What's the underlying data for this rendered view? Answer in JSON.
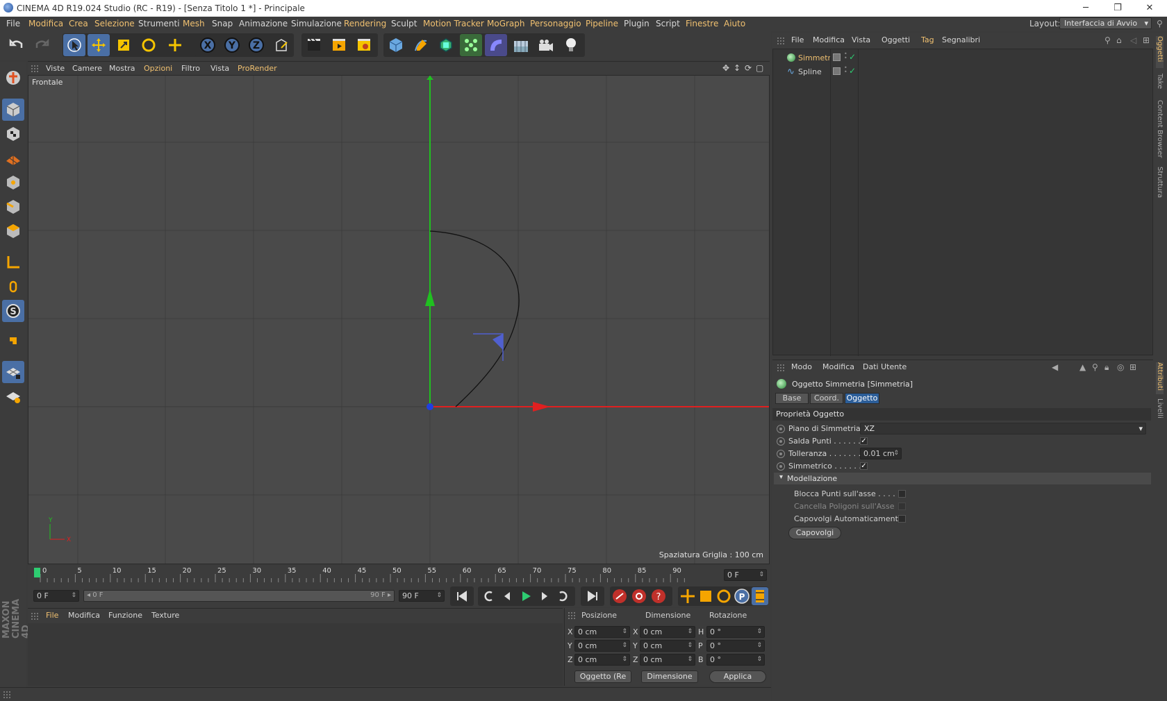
{
  "window": {
    "title": "CINEMA 4D R19.024 Studio (RC - R19) - [Senza Titolo 1 *] - Principale",
    "controls": [
      "─",
      "❐",
      "✕"
    ]
  },
  "menubar": {
    "items": [
      "File",
      "Modifica",
      "Crea",
      "Selezione",
      "Strumenti",
      "Mesh",
      "Snap",
      "Animazione",
      "Simulazione",
      "Rendering",
      "Sculpt",
      "Motion Tracker",
      "MoGraph",
      "Personaggio",
      "Pipeline",
      "Plugin",
      "Script",
      "Finestre",
      "Aiuto"
    ],
    "layout_label": "Layout:",
    "layout_value": "Interfaccia di Avvio"
  },
  "viewport": {
    "menu": [
      "Viste",
      "Camere",
      "Mostra",
      "Opzioni",
      "Filtro",
      "Vista",
      "ProRender"
    ],
    "view_name": "Frontale",
    "grid_info": "Spaziatura Griglia : 100 cm",
    "axis_y": "Y",
    "axis_x": "X"
  },
  "timeline": {
    "ticks": [
      "0",
      "5",
      "10",
      "15",
      "20",
      "25",
      "30",
      "35",
      "40",
      "45",
      "50",
      "55",
      "60",
      "65",
      "70",
      "75",
      "80",
      "85",
      "90"
    ],
    "current_frame": "0 F",
    "start_field": "0 F",
    "range_start": "◂ 0 F",
    "range_end": "90 F ▸",
    "end_field": "90 F"
  },
  "materials": {
    "menu": [
      "File",
      "Modifica",
      "Funzione",
      "Texture"
    ]
  },
  "coords": {
    "headers": [
      "Posizione",
      "Dimensione",
      "Rotazione"
    ],
    "pos": {
      "x": "0 cm",
      "y": "0 cm",
      "z": "0 cm"
    },
    "size": {
      "x": "0 cm",
      "y": "0 cm",
      "z": "0 cm"
    },
    "rot": {
      "h": "0 °",
      "p": "0 °",
      "b": "0 °"
    },
    "axes_pos": [
      "X",
      "Y",
      "Z"
    ],
    "axes_size": [
      "X",
      "Y",
      "Z"
    ],
    "axes_rot": [
      "H",
      "P",
      "B"
    ],
    "mode_button": "Oggetto (Re",
    "size_button": "Dimensione",
    "apply_button": "Applica"
  },
  "object_manager": {
    "menu": [
      "File",
      "Modifica",
      "Vista",
      "Oggetti",
      "Tag",
      "Segnalibri"
    ],
    "objects": [
      {
        "name": "Simmetria",
        "color": "#f0c070",
        "icon": "symmetry-icon"
      },
      {
        "name": "Spline",
        "color": "#d0d0d0",
        "icon": "spline-icon"
      }
    ]
  },
  "attributes": {
    "menu": [
      "Modo",
      "Modifica",
      "Dati Utente"
    ],
    "object_title": "Oggetto Simmetria [Simmetria]",
    "tabs": [
      "Base",
      "Coord.",
      "Oggetto"
    ],
    "section": "Proprietà Oggetto",
    "props": {
      "plane_label": "Piano di Simmetria",
      "plane_value": "XZ",
      "weld_label": "Salda Punti . . . . . .",
      "tolerance_label": "Tolleranza . . . . . . .",
      "tolerance_value": "0.01 cm",
      "symmetric_label": "Simmetrico . . . . . . .",
      "modeling_section": "Modellazione",
      "lock_points": "Blocca Punti sull'asse . . . . . .",
      "delete_polys": "Cancella Poligoni sull'Asse",
      "auto_flip": "Capovolgi Automaticamente",
      "flip_button": "Capovolgi"
    }
  },
  "side_tabs": [
    "Oggetti",
    "Take",
    "Content Browser",
    "Struttura"
  ],
  "side_tabs_attr": [
    "Attributi",
    "Livelli"
  ],
  "brand": "MAXON CINEMA 4D",
  "colors": {
    "accent": "#f0c070",
    "active_tab": "#2c5e99",
    "axis_x": "#e02020",
    "axis_y": "#20c020",
    "origin": "#2040e0"
  }
}
